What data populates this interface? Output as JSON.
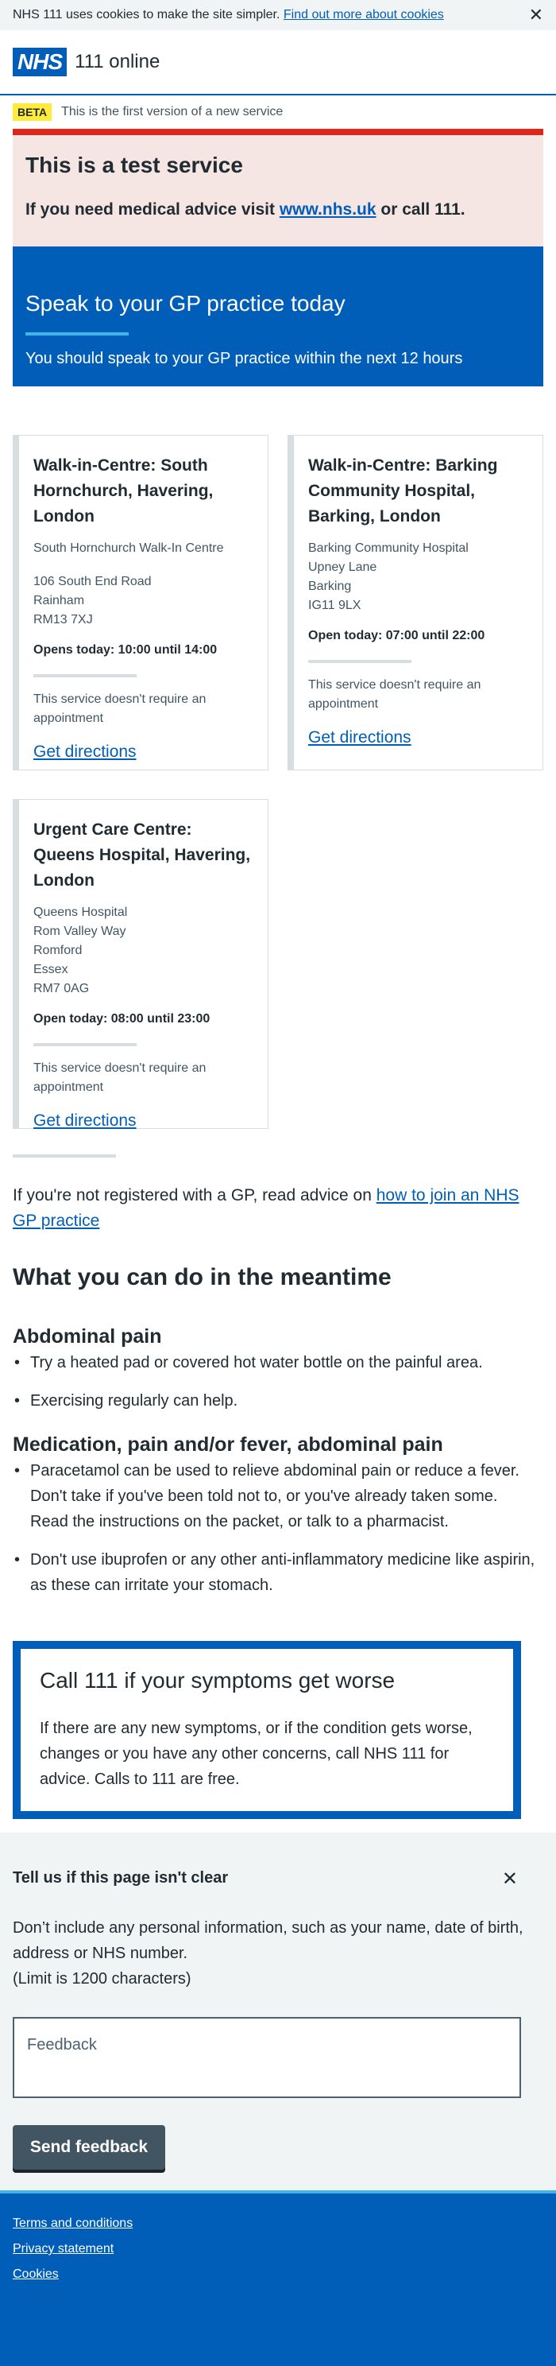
{
  "cookie_banner": {
    "text": "NHS 111 uses cookies to make the site simpler.",
    "link": "Find out more about cookies",
    "close": "✕"
  },
  "header": {
    "logo": "NHS",
    "service_name": "111 online"
  },
  "beta": {
    "tag": "BETA",
    "text": "This is the first version of a new service"
  },
  "test_service": {
    "title": "This is a test service",
    "text_before": "If you need medical advice visit",
    "link": "www.nhs.uk",
    "text_after": "or call 111."
  },
  "care": {
    "title": "Speak to your GP practice today",
    "subtitle": "You should speak to your GP practice within the next 12 hours"
  },
  "services": [
    {
      "name": "Walk-in-Centre: South Hornchurch, Havering, London",
      "org": "South Hornchurch Walk-In Centre",
      "address": [
        "106 South End Road",
        "Rainham",
        "RM13 7XJ"
      ],
      "opens": "Opens today: 10:00 until 14:00",
      "appointment": "This service doesn't require an appointment",
      "directions": "Get directions"
    },
    {
      "name": "Walk-in-Centre: Barking Community Hospital, Barking, London",
      "address": [
        "Barking Community Hospital",
        "Upney Lane",
        "Barking",
        "IG11 9LX"
      ],
      "opens": "Open today: 07:00 until 22:00",
      "appointment": "This service doesn't require an appointment",
      "directions": "Get directions"
    },
    {
      "name": "Urgent Care Centre: Queens Hospital, Havering, London",
      "address": [
        "Queens Hospital",
        "Rom Valley Way",
        "Romford",
        "Essex",
        "RM7 0AG"
      ],
      "opens": "Open today: 08:00 until 23:00",
      "appointment": "This service doesn't require an appointment",
      "directions": "Get directions"
    }
  ],
  "not_registered": {
    "text": "If you're not registered with a GP, read advice on",
    "link": "how to join an NHS GP practice"
  },
  "meantime": {
    "title": "What you can do in the meantime",
    "sections": [
      {
        "title": "Abdominal pain",
        "items": [
          "Try a heated pad or covered hot water bottle on the painful area.",
          "Exercising regularly can help."
        ]
      },
      {
        "title": "Medication, pain and/or fever, abdominal pain",
        "items": [
          "Paracetamol can be used to relieve abdominal pain or reduce a fever. Don't take if you've been told not to, or you've already taken some. Read the instructions on the packet, or talk to a pharmacist.",
          "Don't use ibuprofen or any other anti-inflammatory medicine like aspirin, as these can irritate your stomach."
        ]
      }
    ]
  },
  "callout": {
    "title": "Call 111 if your symptoms get worse",
    "text": "If there are any new symptoms, or if the condition gets worse, changes or you have any other concerns, call NHS 111 for advice. Calls to 111 are free."
  },
  "feedback": {
    "title": "Tell us if this page isn't clear",
    "close": "✕",
    "text": "Don’t include any personal information, such as your name, date of birth, address or NHS number.",
    "limit": "(Limit is 1200 characters)",
    "placeholder": "Feedback",
    "button": "Send feedback"
  },
  "footer": {
    "links": [
      "Terms and conditions",
      "Privacy statement",
      "Cookies"
    ]
  },
  "colors": {
    "nhs_blue": "#005eb8",
    "warning_red": "#da291c",
    "light_blue": "#41b6e6",
    "beta_yellow": "#ffeb3b",
    "grey_bg": "#f0f4f5"
  }
}
